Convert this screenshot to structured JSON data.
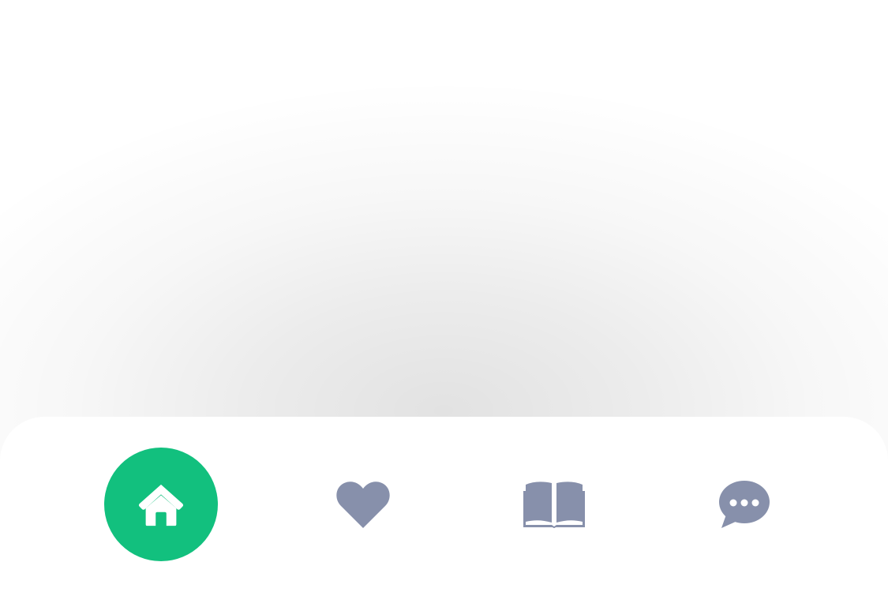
{
  "colors": {
    "accent": "#12C07E",
    "inactive_icon": "#8790AB",
    "active_icon": "#FFFFFF",
    "tab_bar_background": "#FFFFFF"
  },
  "tab_bar": {
    "active_tab": "home",
    "tabs": [
      {
        "id": "home",
        "icon": "home-icon",
        "active": true
      },
      {
        "id": "favorites",
        "icon": "heart-icon",
        "active": false
      },
      {
        "id": "library",
        "icon": "open-book-icon",
        "active": false
      },
      {
        "id": "messages",
        "icon": "chat-bubble-icon",
        "active": false
      }
    ]
  }
}
